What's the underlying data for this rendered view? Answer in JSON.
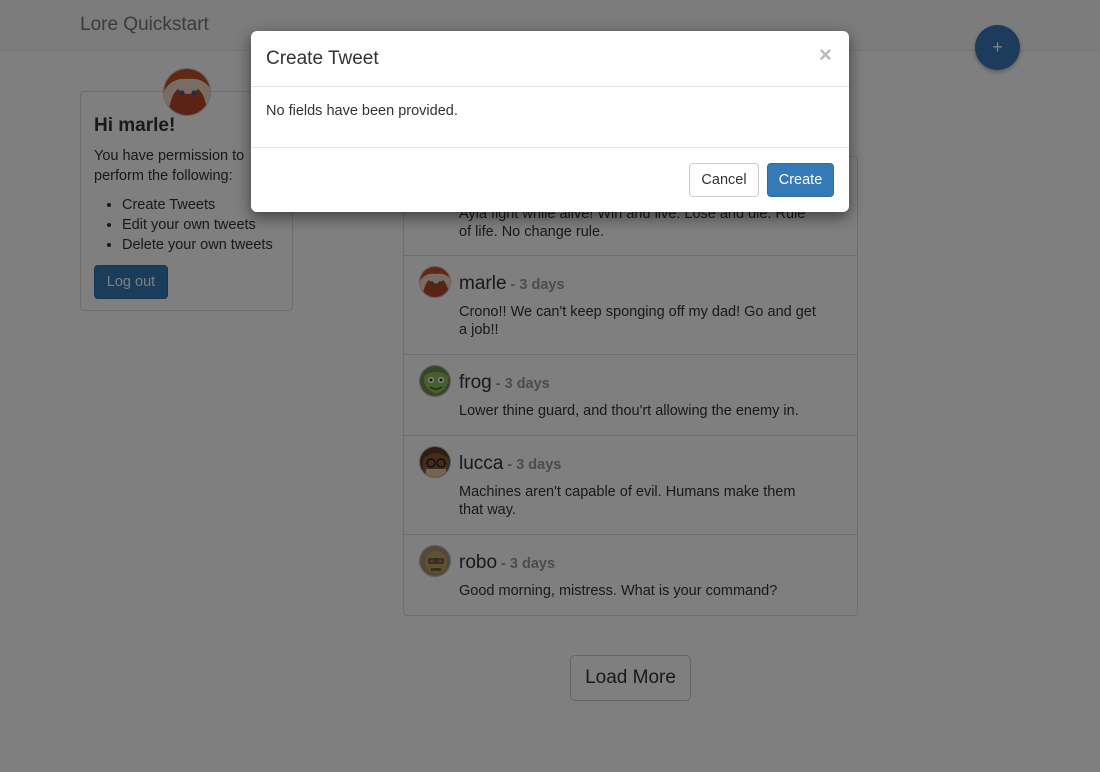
{
  "navbar": {
    "brand": "Lore Quickstart",
    "fab_label": "+"
  },
  "profile": {
    "greeting": "Hi marle!",
    "permission_text": "You have permission to perform the following:",
    "permissions": [
      "Create Tweets",
      "Edit your own tweets",
      "Delete your own tweets"
    ],
    "logout_label": "Log out"
  },
  "tweets": [
    {
      "user": "",
      "time": "",
      "text": "Ayla fight while alive! Win and live. Lose and die. Rule of life. No change rule."
    },
    {
      "user": "marle",
      "time": "- 3 days",
      "text": "Crono!! We can't keep sponging off my dad! Go and get a job!!"
    },
    {
      "user": "frog",
      "time": "- 3 days",
      "text": "Lower thine guard, and thou'rt allowing the enemy in."
    },
    {
      "user": "lucca",
      "time": "- 3 days",
      "text": "Machines aren't capable of evil. Humans make them that way."
    },
    {
      "user": "robo",
      "time": "- 3 days",
      "text": "Good morning, mistress. What is your command?"
    }
  ],
  "load_more_label": "Load More",
  "modal": {
    "title": "Create Tweet",
    "close_label": "×",
    "body": "No fields have been provided.",
    "cancel_label": "Cancel",
    "create_label": "Create"
  },
  "colors": {
    "primary": "#337ab7",
    "fab": "#3b79b7",
    "muted": "#999999"
  },
  "icons": {
    "profile_avatar": "avatar-icon",
    "close": "close-icon"
  }
}
